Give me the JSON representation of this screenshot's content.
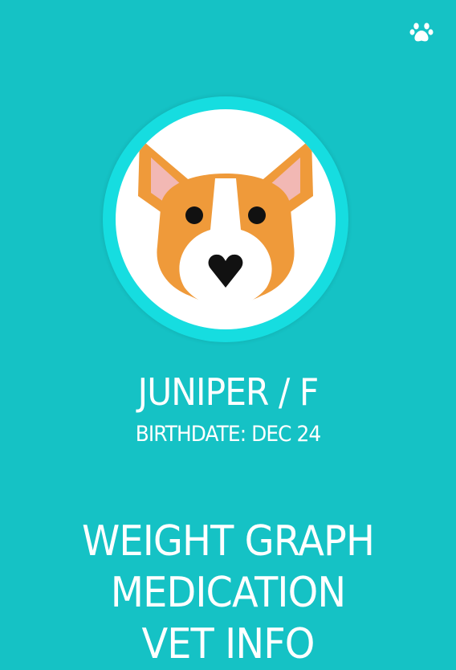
{
  "header": {
    "icon": "paw-icon"
  },
  "profile": {
    "avatar_icon": "corgi-face-icon",
    "name": "JUNIPER / F",
    "birthdate": "BIRTHDATE: DEC 24"
  },
  "menu": {
    "items": [
      {
        "label": "WEIGHT GRAPH"
      },
      {
        "label": "MEDICATION"
      },
      {
        "label": "VET INFO"
      }
    ]
  },
  "colors": {
    "background": "#15c2c5",
    "avatar_ring": "#16dde0",
    "corgi_orange": "#ef9a3a",
    "ear_pink": "#f2b8b4",
    "text": "#ffffff"
  }
}
